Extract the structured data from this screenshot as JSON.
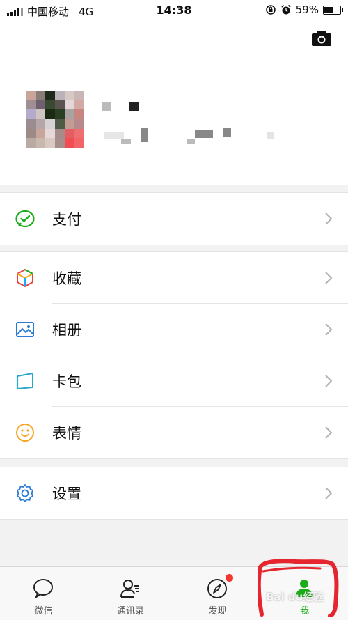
{
  "status_bar": {
    "carrier": "中国移动",
    "network": "4G",
    "time": "14:38",
    "battery": "59%",
    "battery_level": 0.59
  },
  "profile": {
    "camera_icon": "camera-icon",
    "avatar_icon": "avatar-icon"
  },
  "menu": {
    "pay": {
      "label": "支付",
      "icon": "wechat-pay-icon"
    },
    "favorites": {
      "label": "收藏",
      "icon": "cube-icon"
    },
    "album": {
      "label": "相册",
      "icon": "picture-icon"
    },
    "cards": {
      "label": "卡包",
      "icon": "card-icon"
    },
    "stickers": {
      "label": "表情",
      "icon": "smile-icon"
    },
    "settings": {
      "label": "设置",
      "icon": "gear-icon"
    }
  },
  "tabs": [
    {
      "label": "微信",
      "icon": "chat-icon",
      "active": false
    },
    {
      "label": "通讯录",
      "icon": "contacts-icon",
      "active": false
    },
    {
      "label": "发现",
      "icon": "compass-icon",
      "active": false,
      "badge": true
    },
    {
      "label": "我",
      "icon": "person-icon",
      "active": true
    }
  ],
  "colors": {
    "accent": "#1aad19",
    "badge": "#f43530",
    "annotation": "#e5262e"
  },
  "watermark": "Bai du经验"
}
